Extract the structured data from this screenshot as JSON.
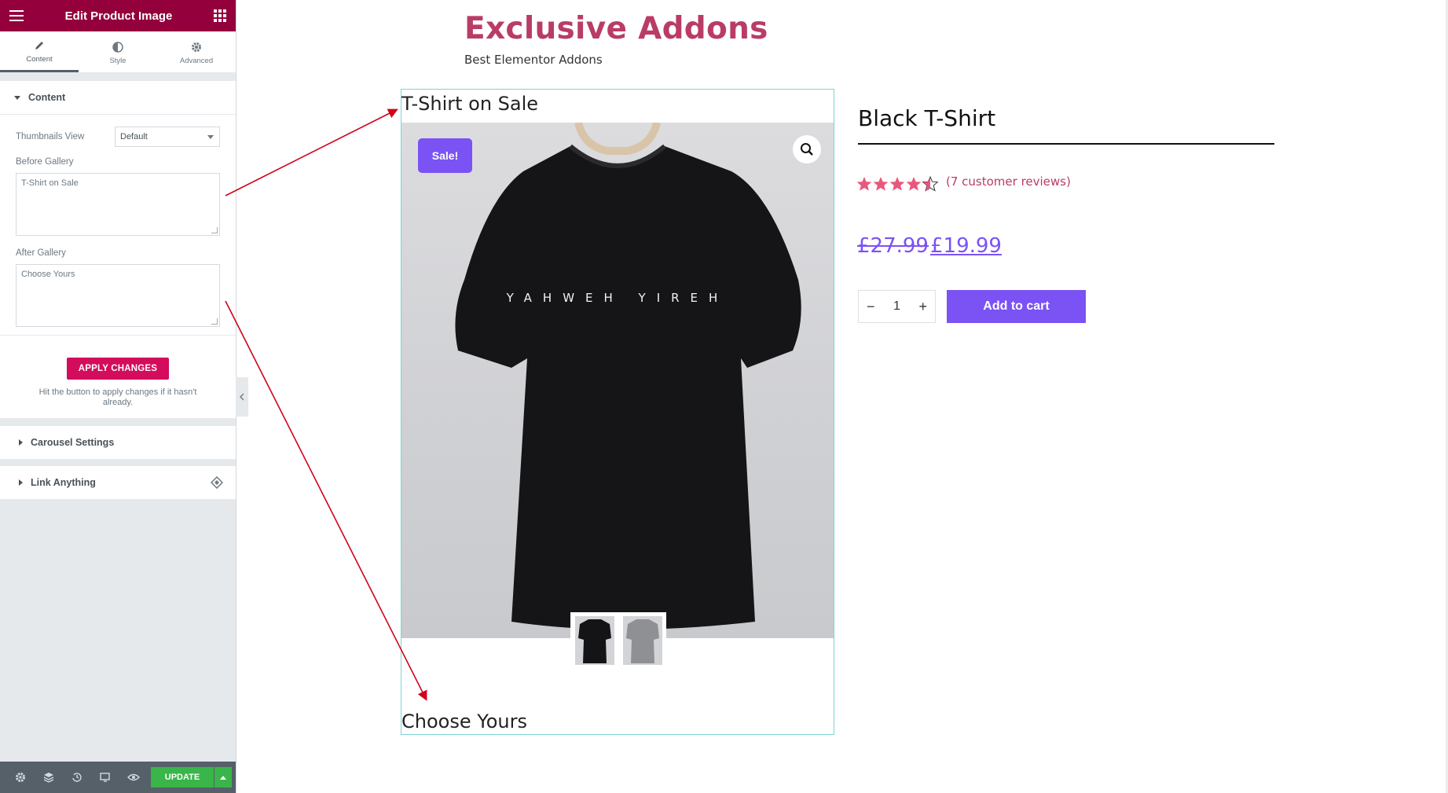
{
  "panel": {
    "title": "Edit Product Image",
    "tabs": [
      {
        "label": "Content"
      },
      {
        "label": "Style"
      },
      {
        "label": "Advanced"
      }
    ],
    "content_section": {
      "heading": "Content",
      "thumbnails_view": {
        "label": "Thumbnails View",
        "value": "Default"
      },
      "before_gallery": {
        "label": "Before Gallery",
        "value": "T-Shirt on Sale"
      },
      "after_gallery": {
        "label": "After Gallery",
        "value": "Choose Yours"
      },
      "apply_button": "APPLY CHANGES",
      "apply_hint": "Hit the button to apply changes if it hasn't already."
    },
    "carousel_section": {
      "heading": "Carousel Settings"
    },
    "link_section": {
      "heading": "Link Anything"
    },
    "footer": {
      "update_label": "UPDATE"
    }
  },
  "site": {
    "title": "Exclusive Addons",
    "tagline": "Best Elementor Addons"
  },
  "gallery": {
    "before_text": "T-Shirt on Sale",
    "after_text": "Choose Yours",
    "sale_badge": "Sale!",
    "shirt_print": "YAHWEH YIREH"
  },
  "product": {
    "title": "Black T-Shirt",
    "rating": 4.5,
    "rating_max": 5,
    "reviews": "(7 customer reviews)",
    "price_old": "£27.99",
    "price_new": "£19.99",
    "quantity": "1",
    "add_to_cart": "Add to cart"
  },
  "colors": {
    "panel_header": "#93003c",
    "accent_pink": "#d30c5c",
    "brand_title": "#b93c67",
    "purple": "#7b52f4",
    "update_green": "#39b54a"
  }
}
